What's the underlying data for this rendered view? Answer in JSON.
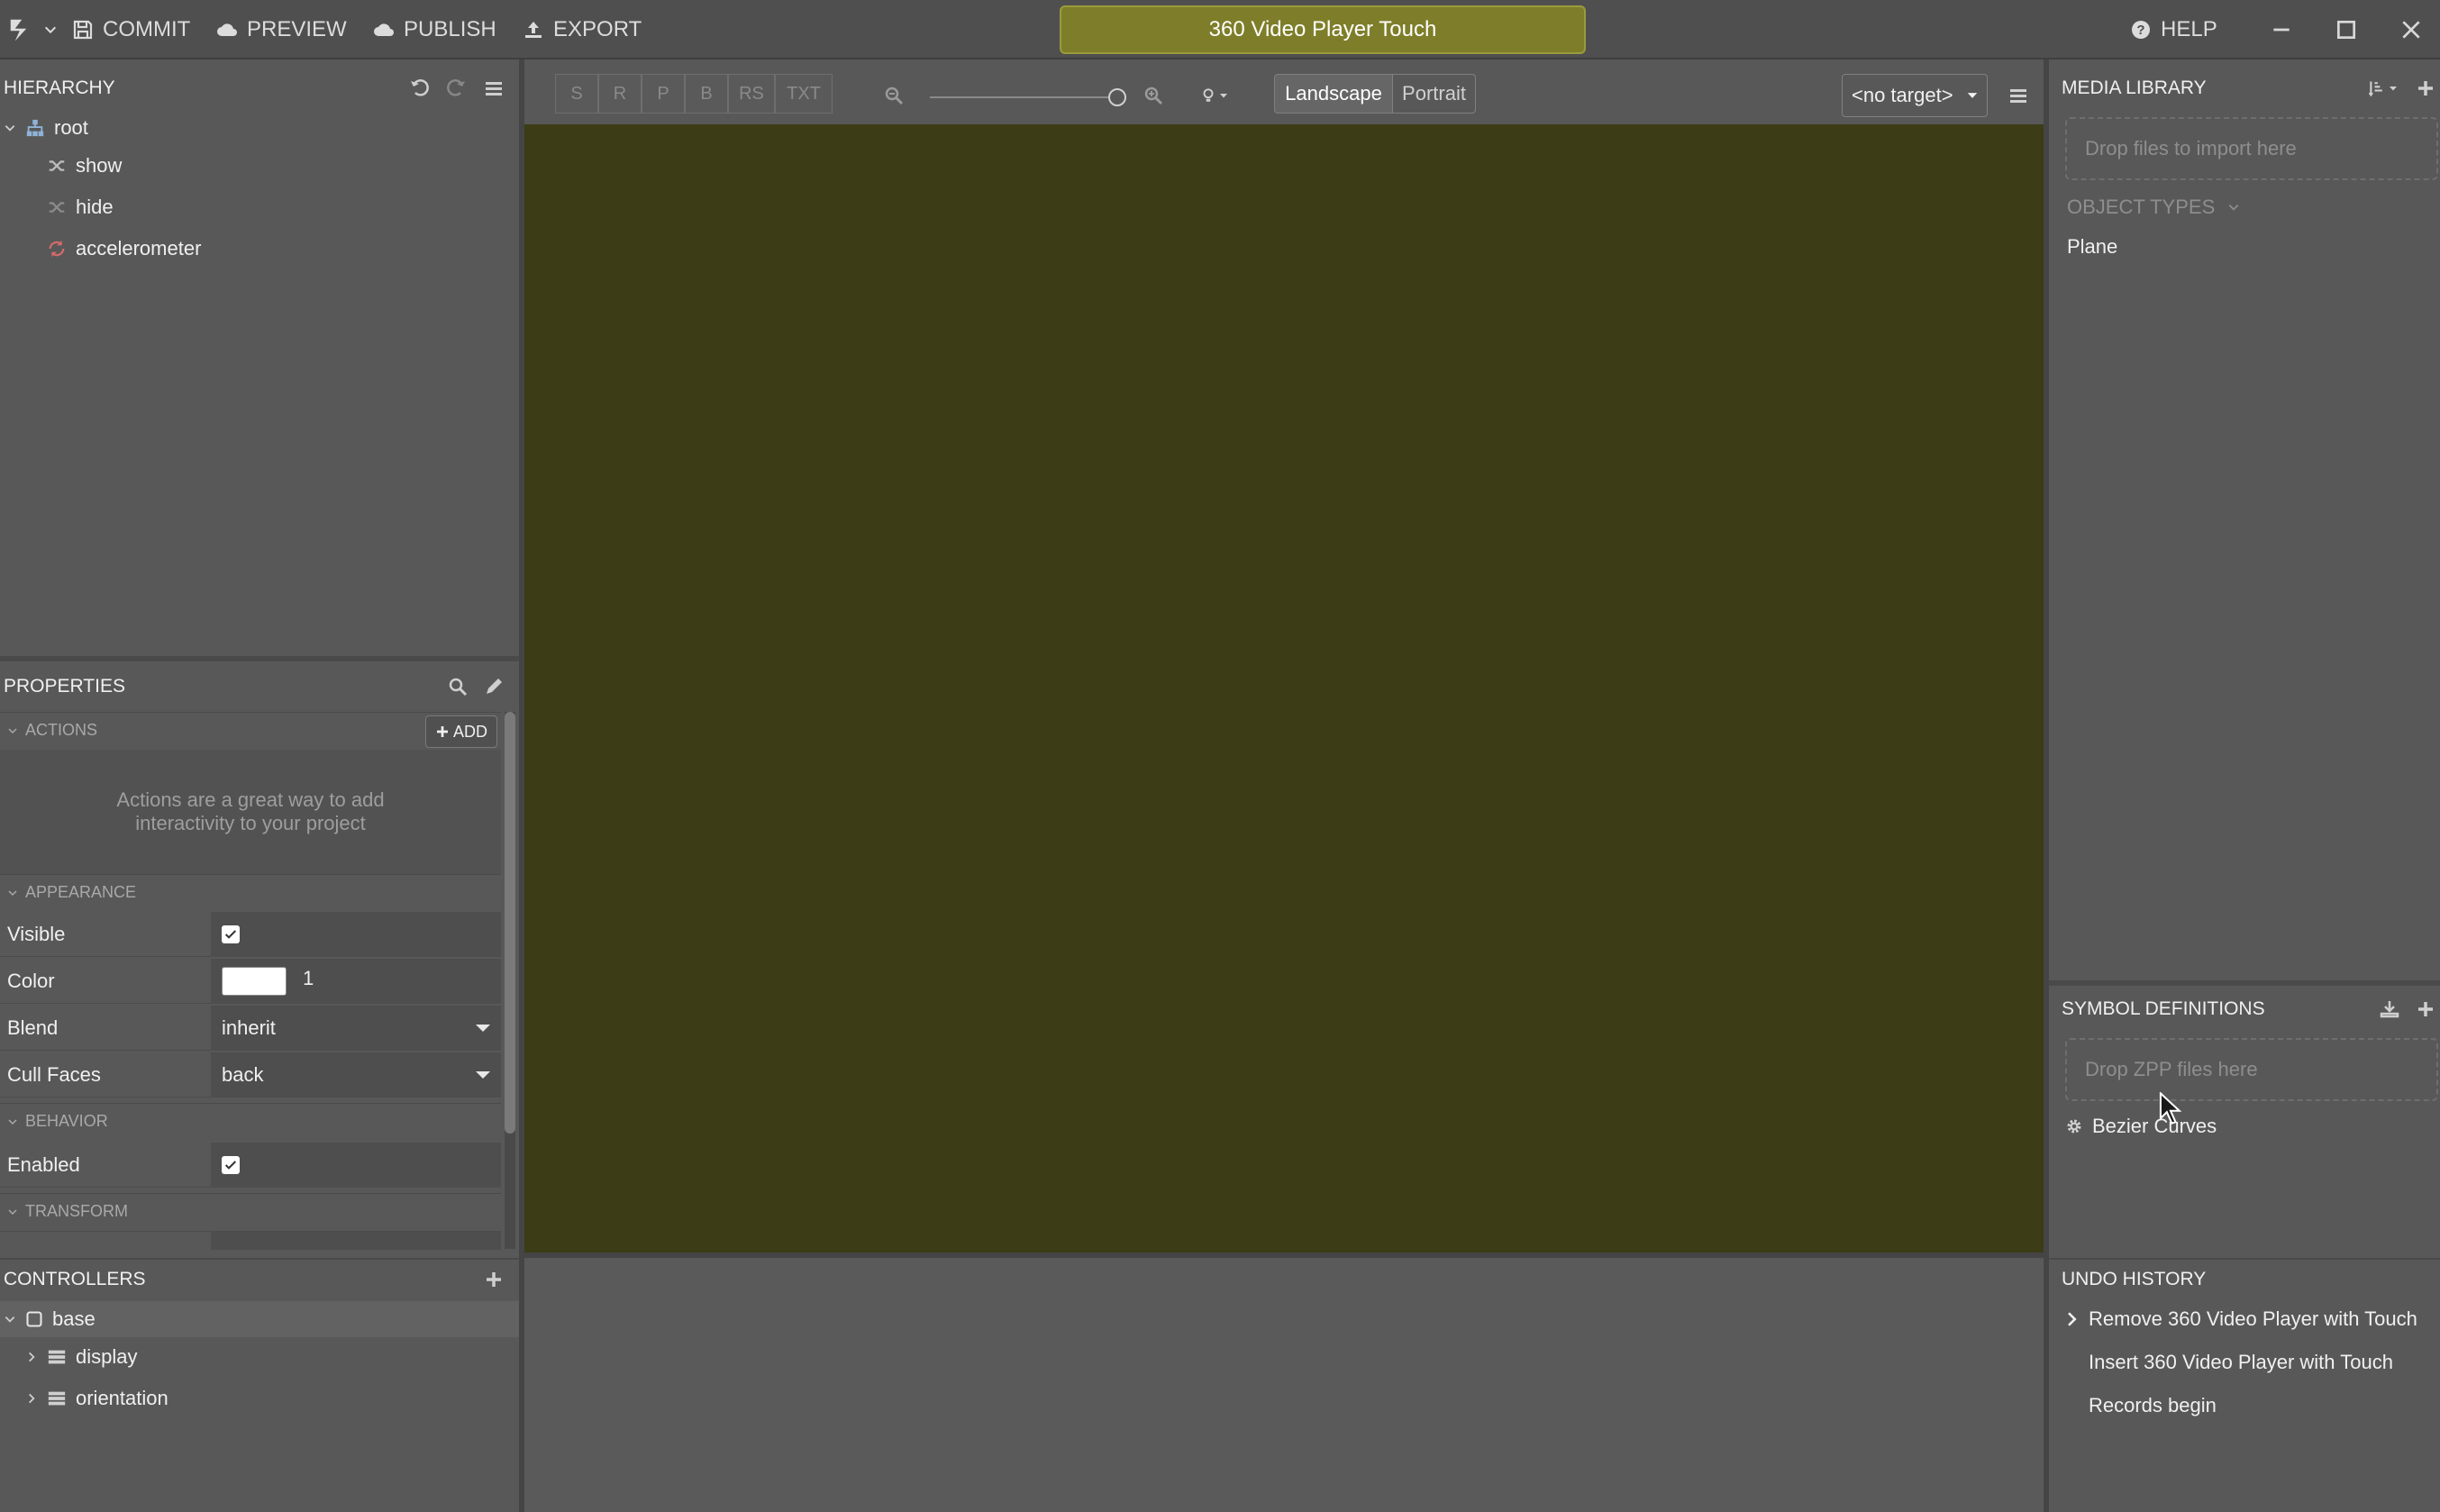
{
  "topbar": {
    "commit": "COMMIT",
    "preview": "PREVIEW",
    "publish": "PUBLISH",
    "export": "EXPORT",
    "project_title": "360 Video Player Touch",
    "help": "HELP"
  },
  "hierarchy": {
    "title": "HIERARCHY",
    "root": "root",
    "items": [
      {
        "label": "show",
        "icon": "shuffle-icon"
      },
      {
        "label": "hide",
        "icon": "shuffle-icon"
      },
      {
        "label": "accelerometer",
        "icon": "refresh-icon"
      }
    ]
  },
  "properties": {
    "title": "PROPERTIES",
    "actions_section": "ACTIONS",
    "add_button": "ADD",
    "actions_hint": "Actions are a great way to add interactivity to your project",
    "appearance_section": "APPEARANCE",
    "rows": {
      "visible": {
        "label": "Visible",
        "checked": true
      },
      "color": {
        "label": "Color",
        "value": "1",
        "swatch": "#ffffff"
      },
      "blend": {
        "label": "Blend",
        "value": "inherit"
      },
      "cull_faces": {
        "label": "Cull Faces",
        "value": "back"
      }
    },
    "behavior_section": "BEHAVIOR",
    "enabled": {
      "label": "Enabled",
      "checked": true
    },
    "transform_section": "TRANSFORM"
  },
  "controllers": {
    "title": "CONTROLLERS",
    "base": "base",
    "items": [
      "display",
      "orientation"
    ]
  },
  "viewport": {
    "tools": [
      "S",
      "R",
      "P",
      "B",
      "RS",
      "TXT"
    ],
    "orientation": {
      "landscape": "Landscape",
      "portrait": "Portrait",
      "selected": "Landscape"
    },
    "target": "<no target>",
    "canvas_color": "#3c3c16"
  },
  "media_library": {
    "title": "MEDIA LIBRARY",
    "dropzone": "Drop files to import here",
    "object_types": "OBJECT TYPES",
    "items": [
      "Plane"
    ]
  },
  "symbol_definitions": {
    "title": "SYMBOL DEFINITIONS",
    "dropzone": "Drop ZPP files here",
    "items": [
      "Bezier Curves"
    ]
  },
  "undo_history": {
    "title": "UNDO HISTORY",
    "items": [
      "Remove 360 Video Player with Touch",
      "Insert 360 Video Player with Touch",
      "Records begin"
    ]
  }
}
